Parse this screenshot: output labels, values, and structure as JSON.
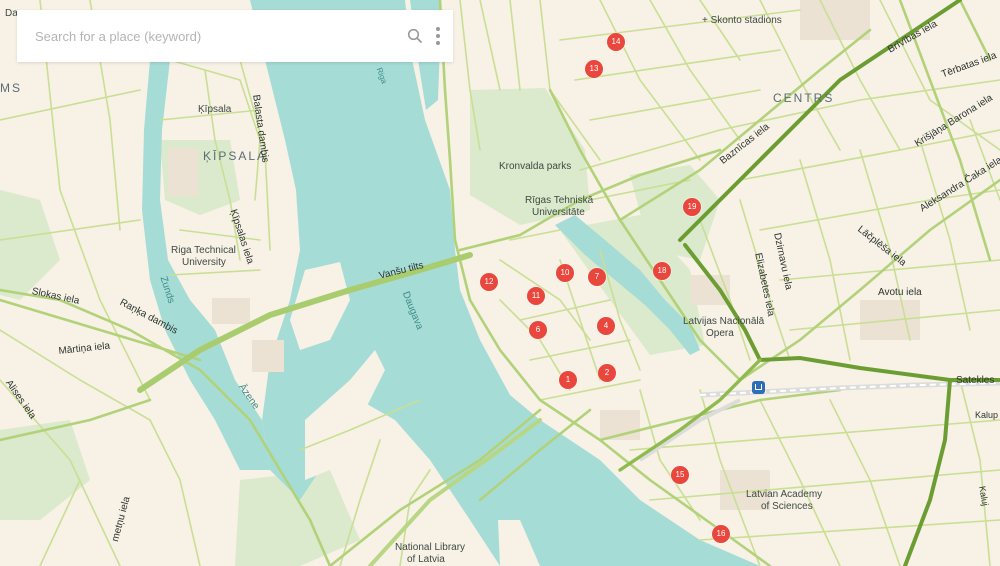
{
  "search": {
    "placeholder": "Search for a place (keyword)",
    "value": ""
  },
  "icons": {
    "search": "search-icon",
    "more": "more-vertical-icon",
    "station": "train-station-icon"
  },
  "colors": {
    "land": "#f7f1e6",
    "water": "#a6dcd6",
    "park": "#dbe9cc",
    "road": "#c7df8d",
    "arterial": "#a3c766",
    "highway": "#6c9d33",
    "marker": "#e9473d"
  },
  "markers": [
    "1",
    "2",
    "4",
    "6",
    "7",
    "10",
    "11",
    "12",
    "13",
    "14",
    "15",
    "16",
    "18",
    "19"
  ],
  "labels": {
    "kipsala_area": "Ķīpsala",
    "kipsala_district": "ĶĪPSALA",
    "centrs": "CENTRS",
    "skonto": "+ Skonto stadions",
    "kronvalda": "Kronvalda parks",
    "rtu_centre_1": "Rīgas Tehniskā",
    "rtu_centre_2": "Universitāte",
    "rtu_1": "Riga Technical",
    "rtu_2": "University",
    "opera_1": "Latvijas Nacionālā",
    "opera_2": "Opera",
    "academy_1": "Latvian Academy",
    "academy_2": "of Sciences",
    "library_1": "National Library",
    "library_2": "of Latvia",
    "vansu": "Vanšu tilts",
    "daugava": "Daugava",
    "zunds": "Zunds",
    "azene": "Āzene",
    "riga_small": "Riga",
    "balasta": "Balasta dambis",
    "kipsalas_iela": "Ķīpsalas iela",
    "slokas": "Slokas iela",
    "ranka": "Raņķa dambis",
    "martina": "Mārtiņa iela",
    "alises": "Alises iela",
    "brivibas": "Brīvības iela",
    "terbatas": "Tērbatas iela",
    "barona": "Krišjāņa Barona iela",
    "caka": "Aleksandra Čaka iela",
    "lacplesa": "Lāčplēša iela",
    "avotu": "Avotu iela",
    "satekles": "Satekles",
    "kalup": "Kalup",
    "dzirnavu": "Dzirnavu iela",
    "elizabetes": "Elizabetes iela",
    "baznicas": "Baznīcas iela",
    "cut_da": "Da",
    "cut_ms": "MS",
    "cut_kaluj": "Kaluj",
    "cut_metnu": "metņu iela",
    "cut_ml": "M"
  }
}
